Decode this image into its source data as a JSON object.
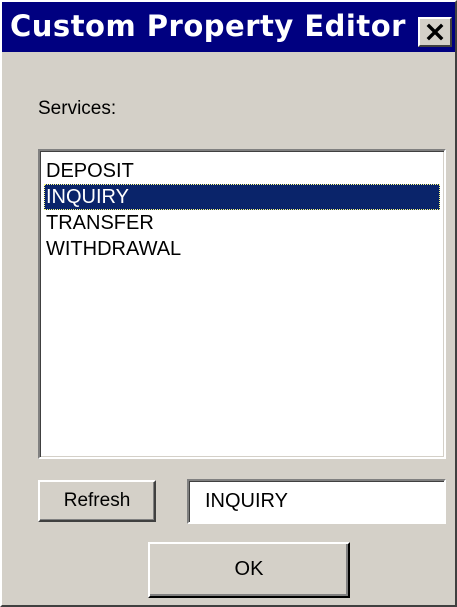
{
  "window": {
    "title": "Custom Property Editor",
    "close_icon": "close-icon"
  },
  "services": {
    "label": "Services:",
    "items": [
      {
        "label": "DEPOSIT",
        "selected": false
      },
      {
        "label": "INQUIRY",
        "selected": true
      },
      {
        "label": "TRANSFER",
        "selected": false
      },
      {
        "label": "WITHDRAWAL",
        "selected": false
      }
    ]
  },
  "controls": {
    "refresh_label": "Refresh",
    "selected_value": "INQUIRY",
    "ok_label": "OK"
  },
  "colors": {
    "titlebar": "#000080",
    "selection": "#0a246a",
    "face": "#d4d0c8"
  }
}
